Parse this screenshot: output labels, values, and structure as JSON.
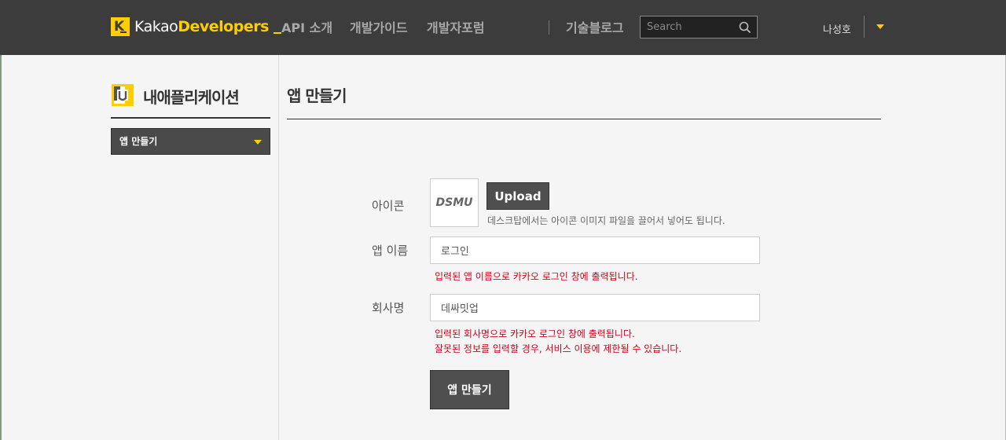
{
  "header": {
    "logo_mark": "K",
    "logo_kakao": "Kakao",
    "logo_developers": "Developers",
    "nav": {
      "api": "API 소개",
      "guide": "개발가이드",
      "forum": "개발자포럼",
      "blog": "기술블로그"
    },
    "search_placeholder": "Search",
    "user_name": "나성호"
  },
  "sidebar": {
    "title": "내애플리케이션",
    "selected": "앱 만들기"
  },
  "main": {
    "title": "앱 만들기",
    "icon_label": "아이콘",
    "icon_preview_text": "DSMU",
    "upload_label": "Upload",
    "icon_hint": "데스크탑에서는 아이콘 이미지 파일을 끌어서 넣어도 됩니다.",
    "name_label": "앱 이름",
    "name_value": "로그인",
    "name_help": "입력된 앱 이름으로 카카오 로그인 창에 출력됩니다.",
    "company_label": "회사명",
    "company_value": "데싸밋업",
    "company_help_1": "입력된 회사명으로 카카오 로그인 창에 출력됩니다.",
    "company_help_2": "잘못된 정보를 입력할 경우, 서비스 이용에 제한될 수 있습니다.",
    "create_button": "앱 만들기"
  },
  "colors": {
    "accent": "#ffcd00",
    "header_bg": "#3c3c3c",
    "error": "#d0021b",
    "button_bg": "#4f4f4f"
  }
}
